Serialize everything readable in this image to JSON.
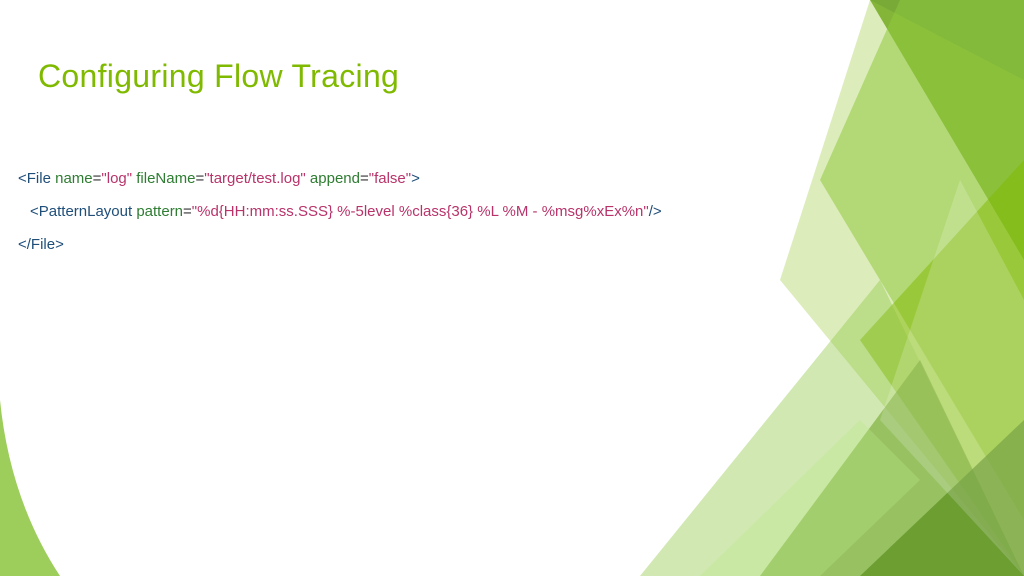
{
  "title": "Configuring Flow Tracing",
  "code": {
    "line1": {
      "open": "<File ",
      "a1": "name",
      "eq1": "=",
      "v1": "\"log\"",
      "sp1": " ",
      "a2": "fileName",
      "eq2": "=",
      "v2": "\"target/test.log\"",
      "sp2": " ",
      "a3": "append",
      "eq3": "=",
      "v3": "\"false\"",
      "close": ">"
    },
    "line2": {
      "open": "<PatternLayout ",
      "a1": "pattern",
      "eq1": "=",
      "v1": "\"%d{HH:mm:ss.SSS} %-5level %class{36} %L %M - %msg%xEx%n\"",
      "close": "/>"
    },
    "line3": {
      "text": "</File>"
    }
  }
}
